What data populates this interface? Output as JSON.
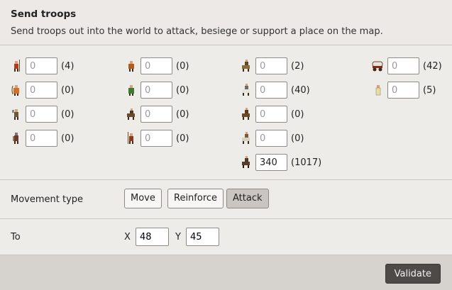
{
  "header": {
    "title": "Send troops",
    "subtitle": "Send troops out into the world to attack, besiege or support a place on the map."
  },
  "units": {
    "u1": {
      "placeholder": "0",
      "value": "",
      "count": "(4)",
      "icon": "spearman-icon",
      "color": "#b33a1f"
    },
    "u2": {
      "placeholder": "0",
      "value": "",
      "count": "(0)",
      "icon": "archer-icon",
      "color": "#d2702a"
    },
    "u3": {
      "placeholder": "0",
      "value": "",
      "count": "(0)",
      "icon": "axeman-icon",
      "color": "#6b5a3a"
    },
    "u4": {
      "placeholder": "0",
      "value": "",
      "count": "(0)",
      "icon": "swordsman-icon",
      "color": "#6b3a2a"
    },
    "u5": {
      "placeholder": "0",
      "value": "",
      "count": "(0)",
      "icon": "slinger-icon",
      "color": "#b35a1f"
    },
    "u6": {
      "placeholder": "0",
      "value": "",
      "count": "(0)",
      "icon": "crossbowman-icon",
      "color": "#3d7a2e"
    },
    "u7": {
      "placeholder": "0",
      "value": "",
      "count": "(0)",
      "icon": "scout-icon",
      "color": "#4a3a2a"
    },
    "u8": {
      "placeholder": "0",
      "value": "",
      "count": "(0)",
      "icon": "halberdier-icon",
      "color": "#8a3a1f"
    },
    "u9": {
      "placeholder": "0",
      "value": "",
      "count": "(2)",
      "icon": "knight-icon",
      "color": "#5a4a2a"
    },
    "u10": {
      "placeholder": "0",
      "value": "",
      "count": "(40)",
      "icon": "lancer-icon",
      "color": "#6b6b6b"
    },
    "u11": {
      "placeholder": "0",
      "value": "",
      "count": "(0)",
      "icon": "horse-archer-icon",
      "color": "#5a3a1f"
    },
    "u12": {
      "placeholder": "0",
      "value": "",
      "count": "(0)",
      "icon": "paladin-icon",
      "color": "#7a5a3a"
    },
    "u13": {
      "placeholder": "0",
      "value": "340",
      "count": "(1017)",
      "icon": "cavalry-icon",
      "color": "#4a3a2a"
    },
    "u14": {
      "placeholder": "0",
      "value": "",
      "count": "(42)",
      "icon": "wagon-icon",
      "color": "#8a2a1f"
    },
    "u15": {
      "placeholder": "0",
      "value": "",
      "count": "(5)",
      "icon": "nobleman-icon",
      "color": "#d8c890"
    }
  },
  "movement": {
    "label": "Movement type",
    "move": "Move",
    "reinforce": "Reinforce",
    "attack": "Attack"
  },
  "to": {
    "label": "To",
    "x_label": "X",
    "x_value": "48",
    "y_label": "Y",
    "y_value": "45"
  },
  "footer": {
    "validate": "Validate"
  }
}
